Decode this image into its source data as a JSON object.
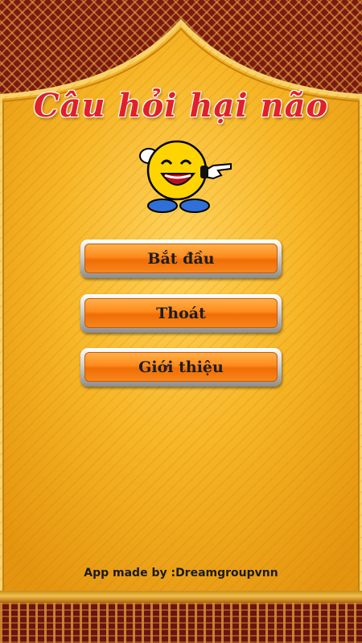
{
  "app": {
    "title": "Câu hỏi hại não"
  },
  "menu": {
    "start_label": "Bắt đầu",
    "exit_label": "Thoát",
    "about_label": "Giới thiệu"
  },
  "footer": {
    "credit": "App made by :Dreamgroupvnn"
  },
  "colors": {
    "title": "#e0202c",
    "button_orange": "#ff8a1c",
    "panel_gold": "#f2b21e",
    "border_maroon": "#7a1a12"
  }
}
